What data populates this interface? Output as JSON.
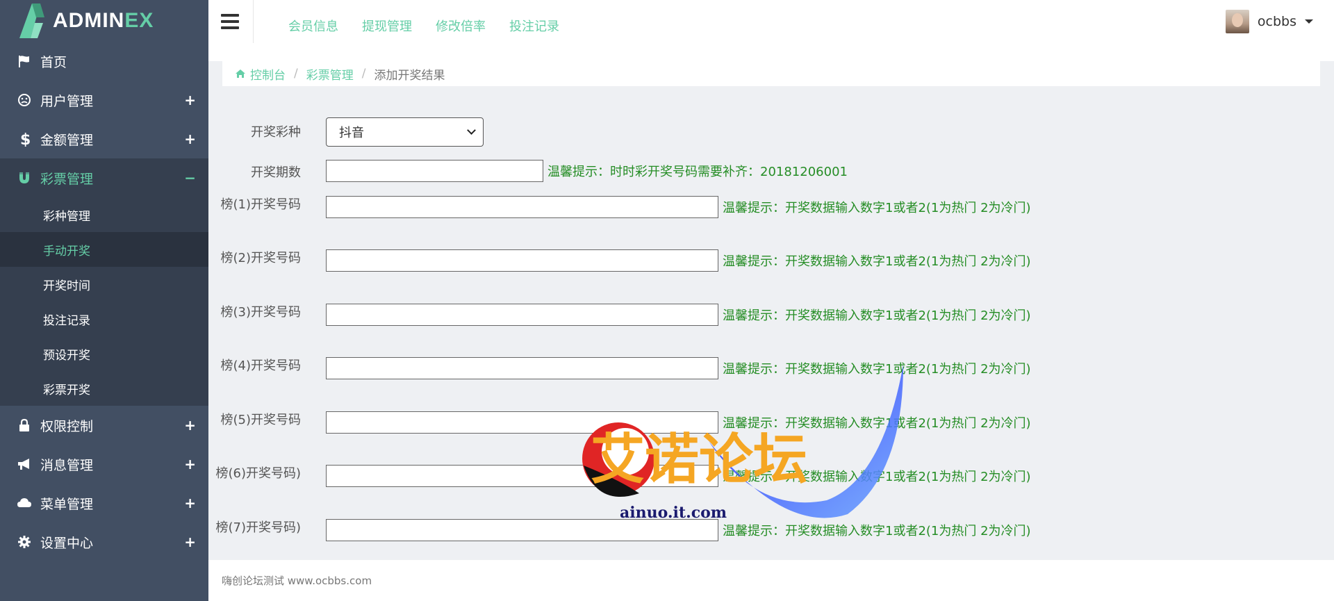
{
  "logo": {
    "main": "ADMIN",
    "accent": "EX"
  },
  "sidebar": {
    "items": [
      {
        "label": "首页",
        "icon": "flag-icon",
        "toggle": ""
      },
      {
        "label": "用户管理",
        "icon": "user-face-icon",
        "toggle": "+"
      },
      {
        "label": "金额管理",
        "icon": "dollar-icon",
        "toggle": "+"
      },
      {
        "label": "彩票管理",
        "icon": "magnet-icon",
        "toggle": "−"
      },
      {
        "label": "权限控制",
        "icon": "lock-icon",
        "toggle": "+"
      },
      {
        "label": "消息管理",
        "icon": "bullhorn-icon",
        "toggle": "+"
      },
      {
        "label": "菜单管理",
        "icon": "cloud-icon",
        "toggle": "+"
      },
      {
        "label": "设置中心",
        "icon": "gear-icon",
        "toggle": "+"
      }
    ],
    "submenu": [
      {
        "label": "彩种管理"
      },
      {
        "label": "手动开奖"
      },
      {
        "label": "开奖时间"
      },
      {
        "label": "投注记录"
      },
      {
        "label": "预设开奖"
      },
      {
        "label": "彩票开奖"
      }
    ],
    "active_item": "彩票管理",
    "active_sub": "手动开奖"
  },
  "header": {
    "nav": [
      "会员信息",
      "提现管理",
      "修改倍率",
      "投注记录"
    ],
    "user_name": "ocbbs"
  },
  "breadcrumb": {
    "home": "控制台",
    "section": "彩票管理",
    "current": "添加开奖结果",
    "separator": "/"
  },
  "form": {
    "lottery_label": "开奖彩种",
    "lottery_value": "抖音",
    "period_label": "开奖期数",
    "period_value": "",
    "period_hint": "温馨提示：时时彩开奖号码需要补齐：20181206001",
    "ranks": [
      {
        "label": "榜(1)开奖号码",
        "value": "",
        "hint": "温馨提示：开奖数据输入数字1或者2(1为热门 2为冷门)"
      },
      {
        "label": "榜(2)开奖号码",
        "value": "",
        "hint": "温馨提示：开奖数据输入数字1或者2(1为热门 2为冷门)"
      },
      {
        "label": "榜(3)开奖号码",
        "value": "",
        "hint": "温馨提示：开奖数据输入数字1或者2(1为热门 2为冷门)"
      },
      {
        "label": "榜(4)开奖号码",
        "value": "",
        "hint": "温馨提示：开奖数据输入数字1或者2(1为热门 2为冷门)"
      },
      {
        "label": "榜(5)开奖号码",
        "value": "",
        "hint": "温馨提示：开奖数据输入数字1或者2(1为热门 2为冷门)"
      },
      {
        "label": "榜(6)开奖号码)",
        "value": "",
        "hint": "温馨提示：开奖数据输入数字1或者2(1为热门 2为冷门)"
      },
      {
        "label": "榜(7)开奖号码)",
        "value": "",
        "hint": "温馨提示：开奖数据输入数字1或者2(1为热门 2为冷门)"
      }
    ]
  },
  "footer": {
    "text": "嗨创论坛测试 www.ocbbs.com"
  },
  "watermark": {
    "title": "艾诺论坛",
    "url": "ainuo.it.com"
  },
  "colors": {
    "sidebar": "#424f63",
    "sidebar_active": "#353f4f",
    "accent": "#65cea7",
    "hint": "#258d25"
  }
}
